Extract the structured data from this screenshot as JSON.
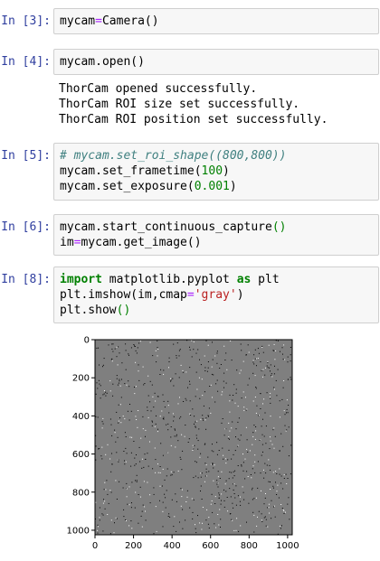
{
  "cells": [
    {
      "prompt": "In [3]:",
      "code": "mycam=Camera()"
    },
    {
      "prompt": "In [4]:",
      "code": "mycam.open()",
      "output": [
        "ThorCam opened successfully.",
        "ThorCam ROI size set successfully.",
        "ThorCam ROI position set successfully."
      ]
    },
    {
      "prompt": "In [5]:",
      "code_lines": [
        "# mycam.set_roi_shape((800,800))",
        "mycam.set_frametime(100)",
        "mycam.set_exposure(0.001)"
      ]
    },
    {
      "prompt": "In [6]:",
      "code_lines": [
        "mycam.start_continuous_capture()",
        "im=mycam.get_image()"
      ]
    },
    {
      "prompt": "In [8]:",
      "code_lines": [
        "import matplotlib.pyplot as plt",
        "plt.imshow(im,cmap='gray')",
        "plt.show()"
      ]
    }
  ],
  "chart_data": {
    "type": "heatmap",
    "colormap": "gray",
    "background_color": "#7f7f7f",
    "x_ticks": [
      "0",
      "200",
      "400",
      "600",
      "800",
      "1000"
    ],
    "y_ticks": [
      "0",
      "200",
      "400",
      "600",
      "800",
      "1000"
    ],
    "xlim": [
      0,
      1024
    ],
    "ylim": [
      1024,
      0
    ],
    "grid": false
  }
}
